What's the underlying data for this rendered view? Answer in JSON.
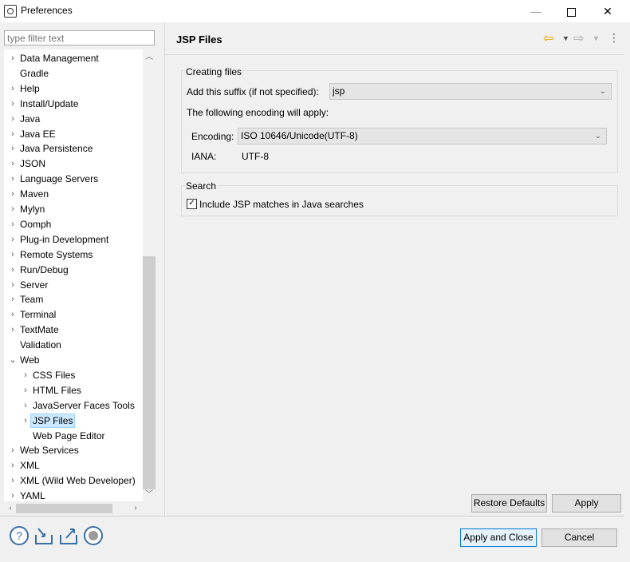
{
  "window": {
    "title": "Preferences",
    "min_label": "—",
    "close_label": "✕"
  },
  "filter": {
    "placeholder": "type filter text"
  },
  "tree": {
    "items": [
      {
        "label": "Data Management",
        "arrow": "›"
      },
      {
        "label": "Gradle",
        "arrow": ""
      },
      {
        "label": "Help",
        "arrow": "›"
      },
      {
        "label": "Install/Update",
        "arrow": "›"
      },
      {
        "label": "Java",
        "arrow": "›"
      },
      {
        "label": "Java EE",
        "arrow": "›"
      },
      {
        "label": "Java Persistence",
        "arrow": "›"
      },
      {
        "label": "JSON",
        "arrow": "›"
      },
      {
        "label": "Language Servers",
        "arrow": "›"
      },
      {
        "label": "Maven",
        "arrow": "›"
      },
      {
        "label": "Mylyn",
        "arrow": "›"
      },
      {
        "label": "Oomph",
        "arrow": "›"
      },
      {
        "label": "Plug-in Development",
        "arrow": "›"
      },
      {
        "label": "Remote Systems",
        "arrow": "›"
      },
      {
        "label": "Run/Debug",
        "arrow": "›"
      },
      {
        "label": "Server",
        "arrow": "›"
      },
      {
        "label": "Team",
        "arrow": "›"
      },
      {
        "label": "Terminal",
        "arrow": "›"
      },
      {
        "label": "TextMate",
        "arrow": "›"
      },
      {
        "label": "Validation",
        "arrow": ""
      },
      {
        "label": "Web",
        "arrow": "⌄"
      },
      {
        "label": "CSS Files",
        "arrow": "›",
        "child": true
      },
      {
        "label": "HTML Files",
        "arrow": "›",
        "child": true
      },
      {
        "label": "JavaServer Faces Tools",
        "arrow": "›",
        "child": true
      },
      {
        "label": "JSP Files",
        "arrow": "›",
        "child": true,
        "selected": true
      },
      {
        "label": "Web Page Editor",
        "arrow": "",
        "child": true
      },
      {
        "label": "Web Services",
        "arrow": "›"
      },
      {
        "label": "XML",
        "arrow": "›"
      },
      {
        "label": "XML (Wild Web Developer)",
        "arrow": "›"
      },
      {
        "label": "YAML",
        "arrow": "›"
      }
    ]
  },
  "page": {
    "title": "JSP Files",
    "creating": {
      "legend": "Creating files",
      "suffix_label": "Add this suffix (if not specified):",
      "suffix_value": "jsp",
      "encoding_note": "The following encoding will apply:",
      "encoding_label": "Encoding:",
      "encoding_value": "ISO 10646/Unicode(UTF-8)",
      "iana_label": "IANA:",
      "iana_value": "UTF-8"
    },
    "search": {
      "legend": "Search",
      "include_label": "Include JSP matches in Java searches",
      "include_checked": true
    },
    "restore_defaults": "Restore Defaults",
    "apply": "Apply"
  },
  "footer": {
    "apply_close": "Apply and Close",
    "cancel": "Cancel"
  },
  "colors": {
    "accent": "#0078d7",
    "selection": "#cce8ff",
    "nav_back": "#e8a800"
  }
}
